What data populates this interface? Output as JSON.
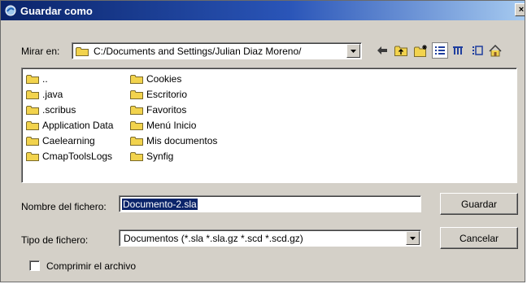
{
  "window": {
    "title": "Guardar como",
    "close_glyph": "×"
  },
  "lookin": {
    "label": "Mirar en:",
    "path": "C:/Documents and Settings/Julian Diaz Moreno/"
  },
  "toolbar_icons": [
    "back-arrow-icon",
    "up-folder-icon",
    "new-folder-icon",
    "detail-view-icon",
    "list-view-icon",
    "preview-view-icon",
    "home-icon"
  ],
  "files": {
    "col1": [
      "..",
      ".java",
      ".scribus",
      "Application Data",
      "Caelearning",
      "CmapToolsLogs"
    ],
    "col2": [
      "Cookies",
      "Escritorio",
      "Favoritos",
      "Menú Inicio",
      "Mis documentos",
      "Synfig"
    ]
  },
  "filename": {
    "label": "Nombre del fichero:",
    "value": "Documento-2.sla"
  },
  "filetype": {
    "label": "Tipo de fichero:",
    "value": "Documentos (*.sla *.sla.gz *.scd *.scd.gz)"
  },
  "buttons": {
    "save": "Guardar",
    "cancel": "Cancelar"
  },
  "compress": {
    "label": "Comprimir el archivo",
    "checked": false
  },
  "colors": {
    "folder": "#f2d34d",
    "title_start": "#0a246a",
    "title_end": "#a6caf0",
    "selection": "#0a246a"
  }
}
